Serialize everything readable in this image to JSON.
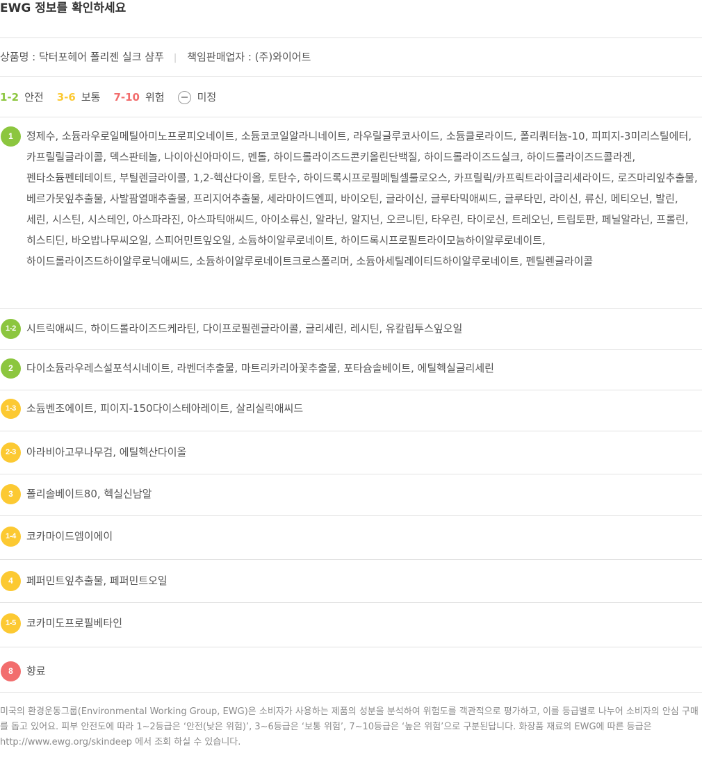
{
  "title": "EWG 정보를 확인하세요",
  "product": {
    "name_text": "상품명 : 닥터포헤어 폴리젠 실크 샴푸",
    "separator": "|",
    "seller_text": "책임판매업자 : (주)와이어트"
  },
  "legend": {
    "safe_range": "1-2",
    "safe_label": "안전",
    "moderate_range": "3-6",
    "moderate_label": "보통",
    "high_range": "7-10",
    "high_label": "위험",
    "undetermined_label": "미정"
  },
  "colors": {
    "safe": "#8cc63f",
    "moderate": "#fcc932",
    "high": "#f26d6d",
    "undetermined": "#999999"
  },
  "ingredients": [
    {
      "grade": "1",
      "level": "safe",
      "text": "정제수, 소듐라우로일메틸아미노프로피오네이트, 소듐코코일알라니네이트, 라우릴글루코사이드, 소듐클로라이드, 폴리쿼터늄-10, 피피지-3미리스틸에터, 카프릴릴글라이콜, 덱스판테놀, 나이아신아마이드, 멘톨, 하이드롤라이즈드콘키올린단백질, 하이드롤라이즈드실크, 하이드롤라이즈드콜라겐, 펜타소듐펜테테이트, 부틸렌글라이콜, 1,2-헥산다이올, 토탄수, 하이드록시프로필메틸셀룰로오스, 카프릴릭/카프릭트라이글리세라이드, 로즈마리잎추출물, 베르가못잎추출물, 사발팜열매추출물, 프리지어추출물, 세라마이드엔피, 바이오틴, 글라이신, 글루타믹애씨드, 글루타민, 라이신, 류신, 메티오닌, 발린, 세린, 시스틴, 시스테인, 아스파라진, 아스파틱애씨드, 아이소류신, 알라닌, 알지닌, 오르니틴, 타우린, 타이로신, 트레오닌, 트립토판, 페닐알라닌, 프롤린, 히스티딘, 바오밥나무씨오일, 스피어민트잎오일, 소듐하이알루로네이트, 하이드록시프로필트라이모늄하이알루로네이트, 하이드롤라이즈드하이알루로닉애씨드, 소듐하이알루로네이트크로스폴리머, 소듐아세틸레이티드하이알루로네이트, 펜틸렌글라이콜"
    },
    {
      "grade": "1-2",
      "level": "safe",
      "text": "시트릭애씨드, 하이드롤라이즈드케라틴, 다이프로필렌글라이콜, 글리세린, 레시틴, 유칼립투스잎오일"
    },
    {
      "grade": "2",
      "level": "safe",
      "text": "다이소듐라우레스설포석시네이트, 라벤더추출물, 마트리카리아꽃추출물, 포타슘솔베이트, 에틸헥실글리세린"
    },
    {
      "grade": "1-3",
      "level": "moderate",
      "text": "소듐벤조에이트, 피이지-150다이스테아레이트, 살리실릭애씨드"
    },
    {
      "grade": "2-3",
      "level": "moderate",
      "text": "아라비아고무나무검, 에틸헥산다이올"
    },
    {
      "grade": "3",
      "level": "moderate",
      "text": "폴리솔베이트80, 헥실신남알"
    },
    {
      "grade": "1-4",
      "level": "moderate",
      "text": "코카마이드엠이에이"
    },
    {
      "grade": "4",
      "level": "moderate",
      "text": "페퍼민트잎추출물, 페퍼민트오일"
    },
    {
      "grade": "1-5",
      "level": "moderate",
      "text": "코카미도프로필베타인"
    },
    {
      "grade": "8",
      "level": "high",
      "text": "향료"
    }
  ],
  "footer": {
    "text": "미국의 환경운동그룹(Environmental Working Group, EWG)은 소비자가 사용하는 제품의 성분을 분석하여 위험도를 객관적으로 평가하고, 이를 등급별로 나누어 소비자의 안심 구매를 돕고 있어요. 피부 안전도에 따라 1~2등급은 ‘안전(낮은 위험)’, 3~6등급은 ‘보통 위험’, 7~10등급은 ‘높은 위험’으로 구분된답니다. 화장품 재료의 EWG에 따른 등급은 http://www.ewg.org/skindeep 에서 조회 하실 수 있습니다."
  }
}
